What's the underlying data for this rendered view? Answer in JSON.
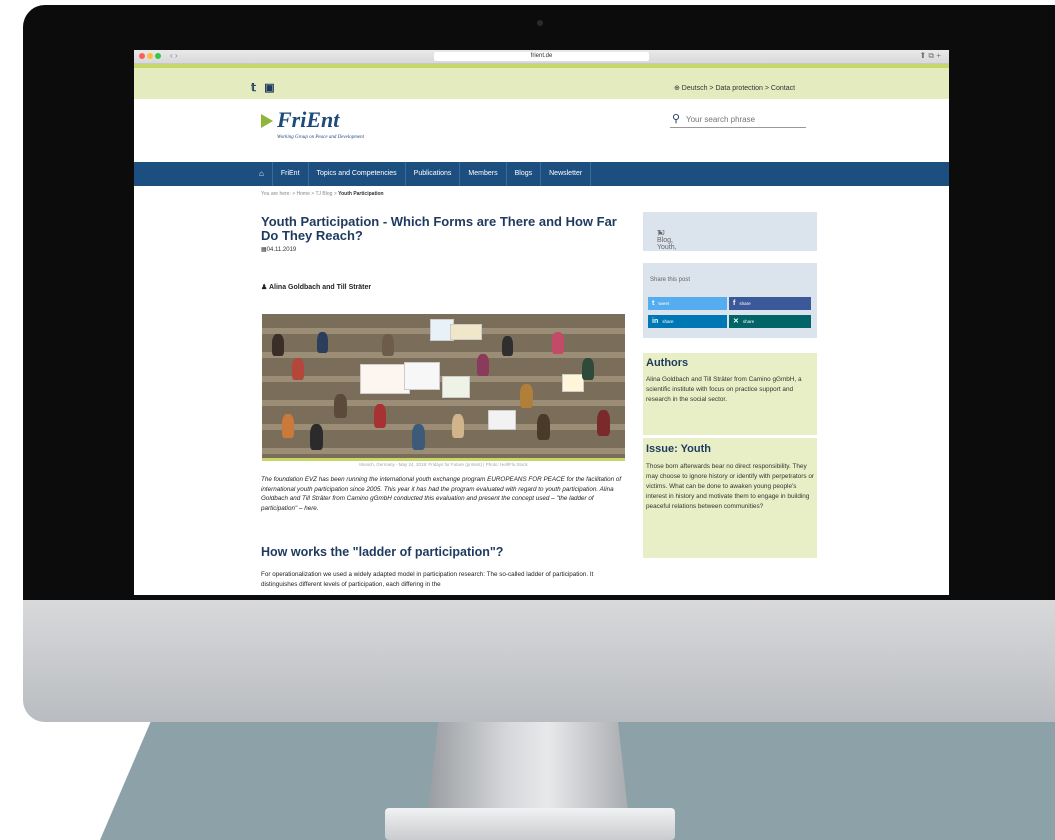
{
  "browser": {
    "url": "frient.de",
    "nav_arrows": "‹ ›",
    "right_icons": "⬆ ⧉ +"
  },
  "topbar": {
    "social_twitter": "𝕥",
    "social_xing": "▣",
    "links": "⊕ Deutsch > Data protection > Contact"
  },
  "header": {
    "logo_text": "FriEnt",
    "logo_sub": "Working Group on Peace and Development",
    "search_placeholder": "Your search phrase"
  },
  "nav": {
    "home_icon": "⌂",
    "items": [
      "FriEnt",
      "Topics and Competencies",
      "Publications",
      "Members",
      "Blogs",
      "Newsletter"
    ]
  },
  "breadcrumb": {
    "trail": "You are here: > Home > TJ Blog >",
    "current": "Youth Participation"
  },
  "article": {
    "title": "Youth Participation - Which Forms are There and How Far Do They Reach?",
    "date": "04.11.2019",
    "authors": "Alina Goldbach and Till Sträter",
    "caption": "Munich, Germany - May 24, 2019: Fridays for Future (protest) | Photo: Hell/Flo.Stock",
    "intro": "The foundation EVZ has been running the international youth exchange program EUROPEANS FOR PEACE for the facilitation of international youth participation since 2005. This year it has had the program evaluated with regard to youth participation. Alina Goldbach and Till Sträter from Camino gGmbH conducted this evaluation and present the concept used – \"the ladder of participation\" – here.",
    "h2": "How works the \"ladder of participation\"?",
    "body": "For operationalization we used a widely adapted model in participation research: The so-called ladder of participation. It distinguishes different levels of participation, each differing in the"
  },
  "sidebar": {
    "tags": "TJ Blog, Youth,",
    "share_title": "Share this post",
    "share_twitter": "tweet",
    "share_facebook": "share",
    "share_linkedin": "share",
    "share_xing": "share",
    "authors_title": "Authors",
    "authors_text": "Alina Goldbach and Till Sträter from Camino gGmbH, a scientific institute with focus on practice support and research in the social sector.",
    "issue_title": "Issue: Youth",
    "issue_text": "Those born afterwards bear no direct responsibility. They may choose to ignore history or identify with perpetrators or victims. What can be done to awaken young people's interest in history and motivate them to engage in building peaceful relations between communities?"
  },
  "colors": {
    "nav_blue": "#1c4f80",
    "accent_green": "#c6d767",
    "sidebar_green": "#e8efc6",
    "sidebar_grey": "#dbe3ec",
    "backdrop_floor": "#8da1a8"
  }
}
